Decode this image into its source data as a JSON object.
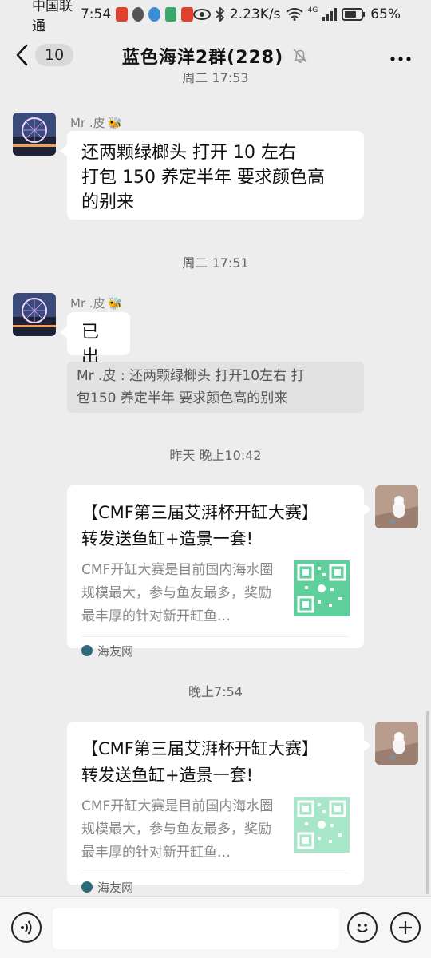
{
  "status": {
    "carrier": "中国联通",
    "time": "7:54",
    "speed": "2.23K/s",
    "network": "4G",
    "battery": "65%"
  },
  "header": {
    "back_count": "10",
    "title": "蓝色海洋2群(228)"
  },
  "messages": {
    "cut_time": "周二 17:53",
    "msg1": {
      "sender": "Mr .皮",
      "line1": "还两颗绿榔头  打开 10 左右",
      "line2": "打包 150  养定半年     要求颜色高",
      "line3": "的别来"
    },
    "time2": "周二 17:51",
    "msg2": {
      "sender": "Mr .皮",
      "text": "已出",
      "quote_line1": "Mr .皮  :  还两颗绿榔头  打开10左右   打",
      "quote_line2": "包150  养定半年     要求颜色高的别来"
    },
    "time3": "昨天 晚上10:42",
    "card1": {
      "title_line1": "【CMF第三届艾湃杯开缸大赛】",
      "title_line2": "转发送鱼缸+造景一套!",
      "desc": "CMF开缸大赛是目前国内海水圈规模最大，参与鱼友最多，奖励最丰厚的针对新开缸鱼…",
      "source": "海友网"
    },
    "time4": "晚上7:54",
    "card2": {
      "title_line1": "【CMF第三届艾湃杯开缸大赛】",
      "title_line2": "转发送鱼缸+造景一套!",
      "desc": "CMF开缸大赛是目前国内海水圈规模最大，参与鱼友最多，奖励最丰厚的针对新开缸鱼…",
      "source": "海友网"
    }
  },
  "colors": {
    "background": "#ededed",
    "bubble": "#ffffff",
    "qr_green": "#5fcf9b"
  }
}
